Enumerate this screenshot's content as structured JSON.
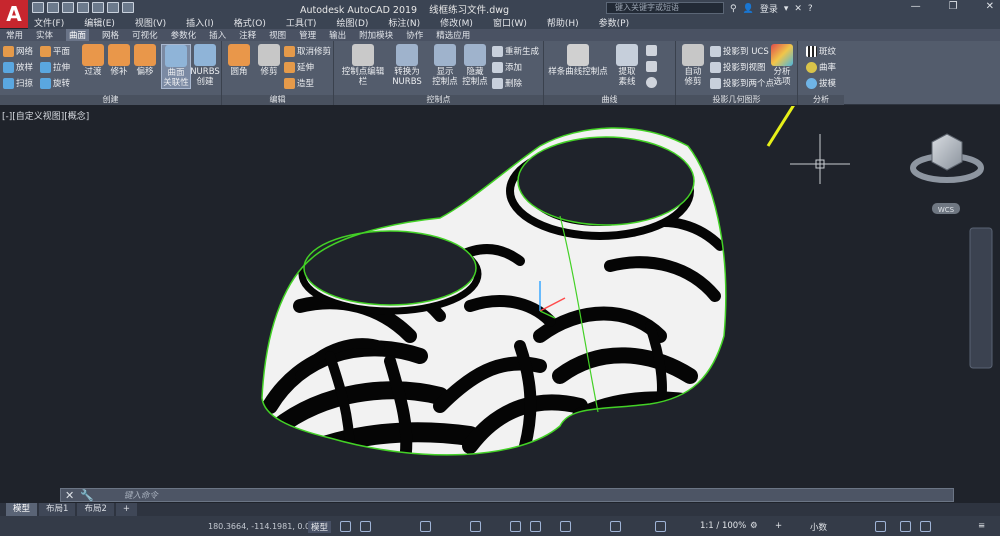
{
  "app": {
    "logo": "A",
    "title": "Autodesk AutoCAD 2019    线框练习文件.dwg"
  },
  "search": {
    "placeholder": "键入关键字或短语"
  },
  "titlebar_tools": {
    "login": "登录"
  },
  "menu": [
    "文件(F)",
    "编辑(E)",
    "视图(V)",
    "插入(I)",
    "格式(O)",
    "工具(T)",
    "绘图(D)",
    "标注(N)",
    "修改(M)",
    "窗口(W)",
    "帮助(H)",
    "参数(P)"
  ],
  "ribbon_tabs": [
    "常用",
    "实体",
    "曲面",
    "网格",
    "可视化",
    "参数化",
    "插入",
    "注释",
    "视图",
    "管理",
    "输出",
    "附加模块",
    "协作",
    "精选应用"
  ],
  "ribbon_active_tab": "曲面",
  "panels": {
    "create": {
      "title": "创建",
      "small_left": [
        "网络",
        "放样",
        "扫掠"
      ],
      "small_right": [
        "平面",
        "拉伸",
        "旋转"
      ],
      "big": [
        "过渡",
        "修补",
        "偏移"
      ],
      "big2": [
        "曲面\n关联性",
        "NURBS\n创建"
      ]
    },
    "edit": {
      "title": "编辑",
      "big": [
        "圆角",
        "修剪"
      ],
      "small": [
        "取消修剪",
        "延伸",
        "造型"
      ]
    },
    "control_points": {
      "title": "控制点",
      "big": [
        "控制点编辑栏",
        "转换为\nNURBS",
        "显示\n控制点",
        "隐藏\n控制点"
      ],
      "small": [
        "重新生成",
        "添加",
        "删除"
      ]
    },
    "curves": {
      "title": "曲线",
      "big": [
        "样条曲线控制点",
        "提取\n素线"
      ]
    },
    "project": {
      "title": "投影几何图形",
      "big": [
        "自动\n修剪"
      ],
      "small": [
        "投影到 UCS",
        "投影到视图",
        "投影到两个点"
      ]
    },
    "analysis": {
      "title": "分析",
      "big": [
        "分析\n选项"
      ],
      "small": [
        "斑纹",
        "曲率",
        "拔模"
      ]
    }
  },
  "viewport": {
    "label": "[-][自定义视图][概念]",
    "wcs": "WCS"
  },
  "command": {
    "placeholder": "键入命令"
  },
  "layout_tabs": [
    "模型",
    "布局1",
    "布局2"
  ],
  "status": {
    "coords": "180.3664, -114.1981, 0.0000",
    "model": "模型",
    "scale": "1:1 / 100%",
    "units": "小数"
  },
  "colors": {
    "accent": "#c7262e",
    "edge_highlight": "#43d126",
    "arrow": "#e7f019"
  },
  "icons": [
    "new-icon",
    "open-icon",
    "save-icon",
    "print-icon",
    "undo-icon",
    "redo-icon",
    "search-icon",
    "user-icon",
    "help-icon",
    "viewcube-icon",
    "zebra-icon",
    "curvature-icon",
    "draft-icon"
  ]
}
